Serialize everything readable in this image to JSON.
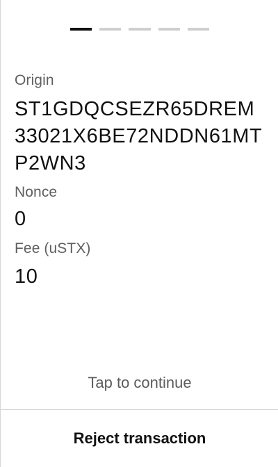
{
  "progress": {
    "total_steps": 5,
    "current_step": 1
  },
  "transaction": {
    "origin_label": "Origin",
    "origin_value": "ST1GDQCSEZR65DREM33021X6BE72NDDN61MTP2WN3",
    "nonce_label": "Nonce",
    "nonce_value": "0",
    "fee_label": "Fee (uSTX)",
    "fee_value": "10"
  },
  "footer": {
    "tap_hint": "Tap to continue",
    "reject_label": "Reject transaction"
  },
  "colors": {
    "active_step": "#111111",
    "inactive_step": "#cfcfcf",
    "label_text": "#5f5f5f",
    "value_text": "#111111"
  }
}
